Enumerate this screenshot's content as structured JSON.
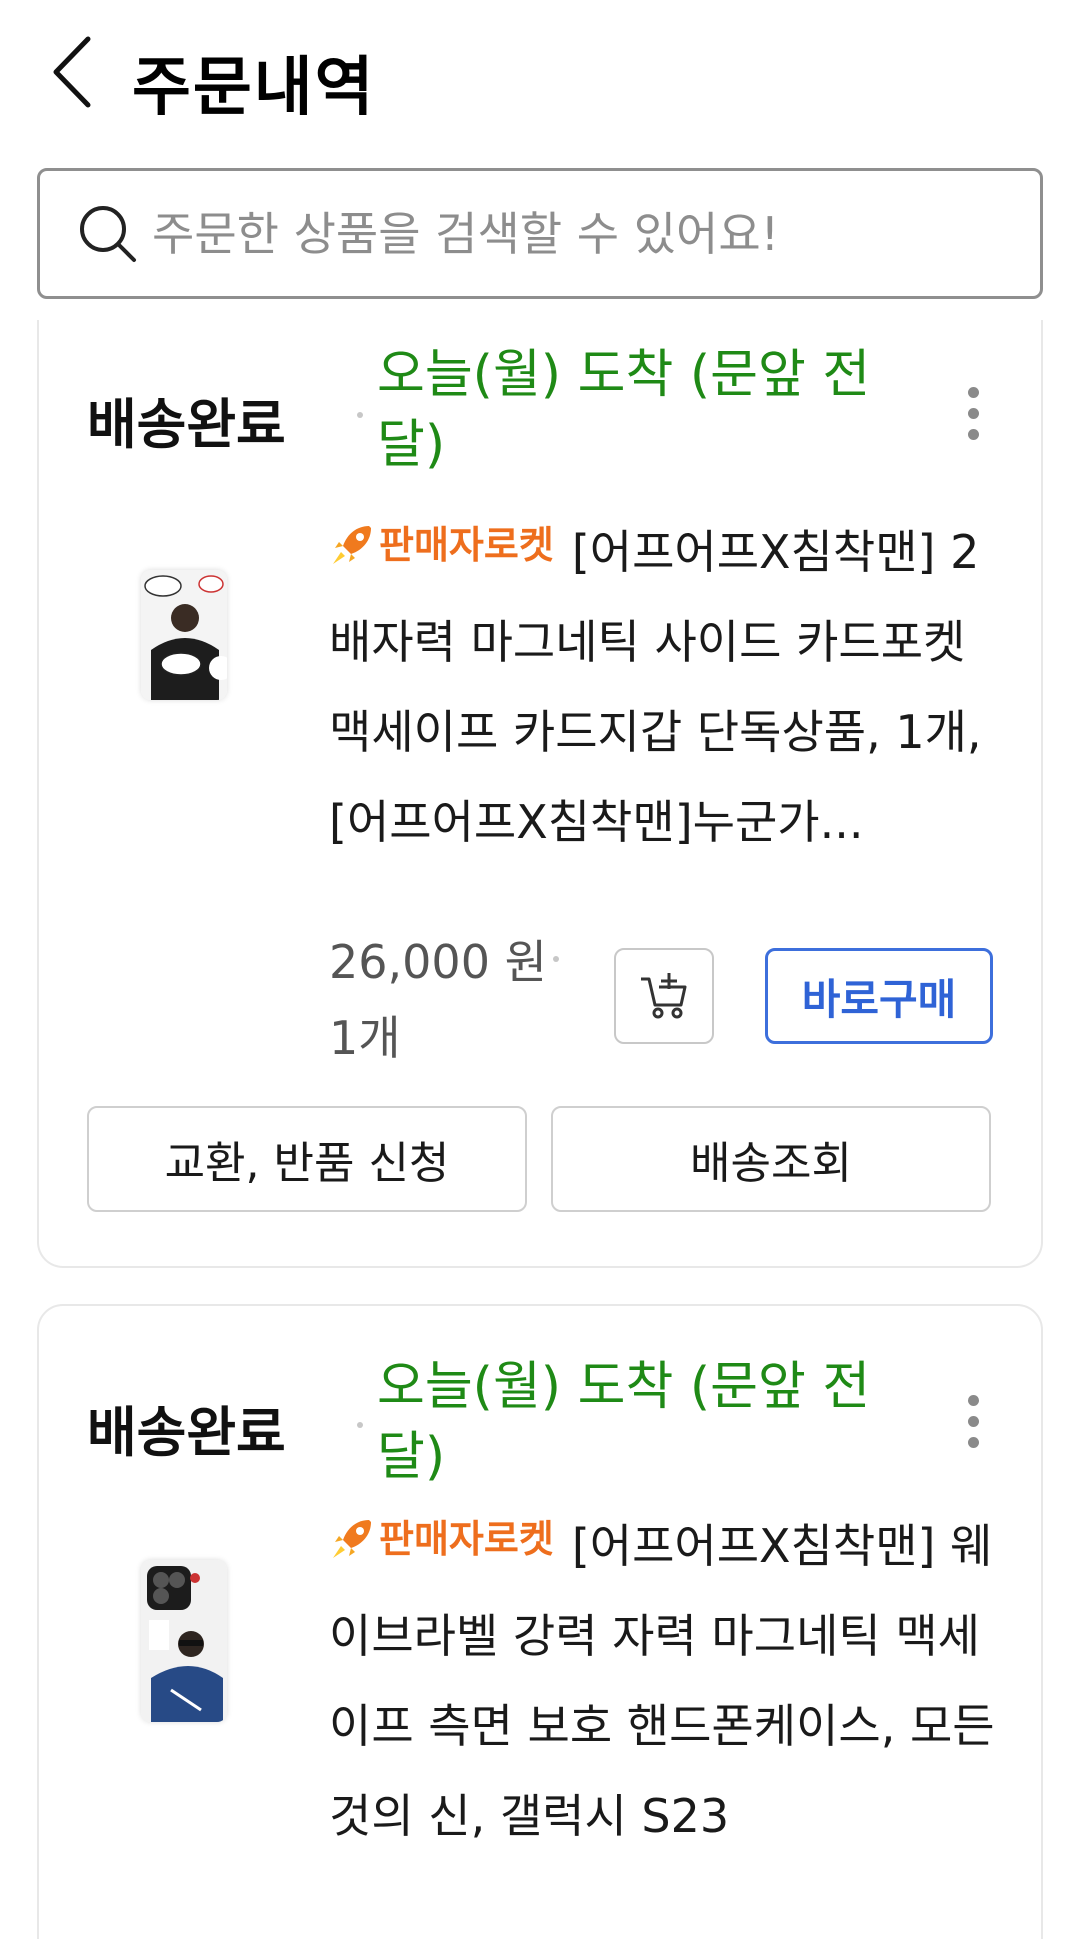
{
  "header": {
    "title": "주문내역"
  },
  "search": {
    "placeholder": "주문한 상품을 검색할 수 있어요!"
  },
  "orders": [
    {
      "status": "배송완료",
      "arrival": "오늘(월) 도착 (문앞 전달)",
      "badge": "판매자로켓",
      "product_name": "[어프어프X침착맨] 2배자력 마그네틱 사이드 카드포켓 맥세이프 카드지갑 단독상품, 1개, [어프어프X침착맨]누군가...",
      "price": "26,000 원",
      "quantity": "1개",
      "buy_label": "바로구매",
      "exchange_label": "교환, 반품 신청",
      "tracking_label": "배송조회"
    },
    {
      "status": "배송완료",
      "arrival": "오늘(월) 도착 (문앞 전달)",
      "badge": "판매자로켓",
      "product_name": "[어프어프X침착맨] 웨이브라벨 강력 자력 마그네틱 맥세이프 측면 보호 핸드폰케이스, 모든 것의 신, 갤럭시 S23"
    }
  ],
  "colors": {
    "arrival_green": "#1f8a16",
    "badge_orange": "#ee6e1d",
    "buy_blue": "#2f63d6"
  },
  "icons": [
    "back-arrow-icon",
    "search-icon",
    "more-vertical-icon",
    "rocket-icon",
    "add-to-cart-icon"
  ]
}
